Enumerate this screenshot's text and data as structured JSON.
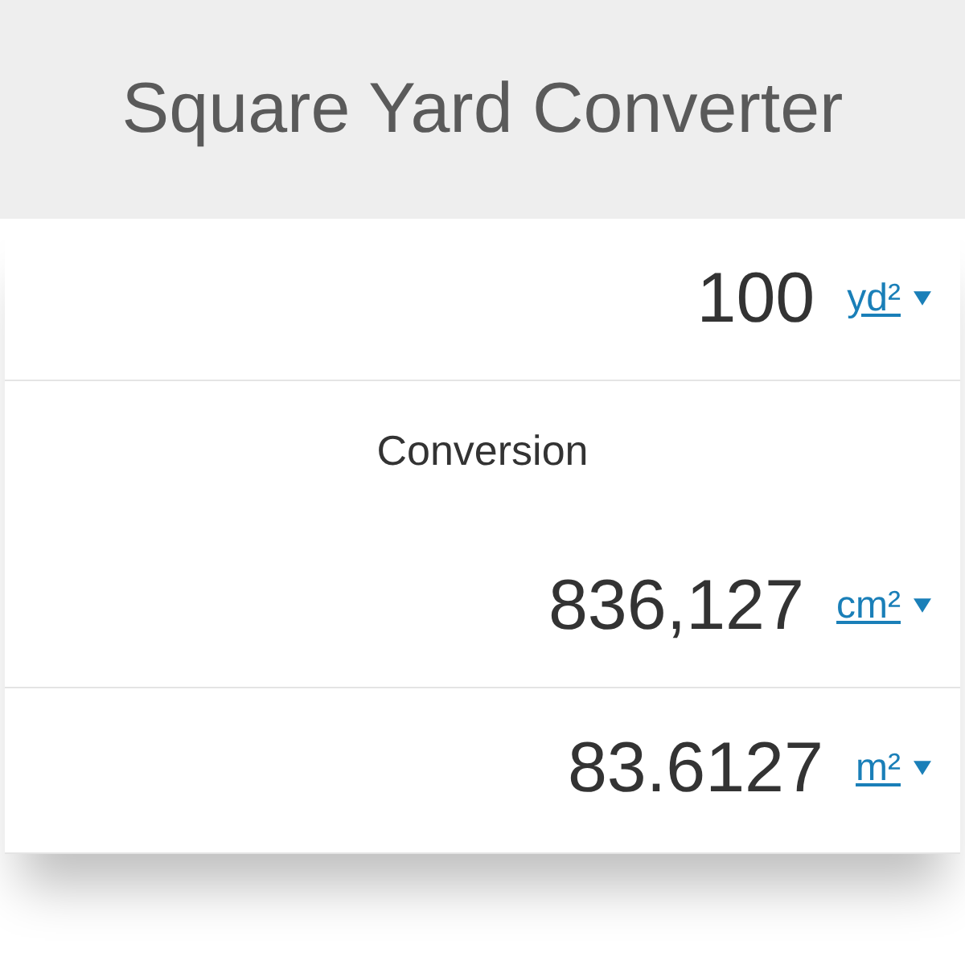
{
  "title": "Square Yard Converter",
  "input": {
    "value": "100",
    "unit": "yd²"
  },
  "conversion_label": "Conversion",
  "results": [
    {
      "value": "836,127",
      "unit": "cm²"
    },
    {
      "value": "83.6127",
      "unit": "m²"
    }
  ]
}
